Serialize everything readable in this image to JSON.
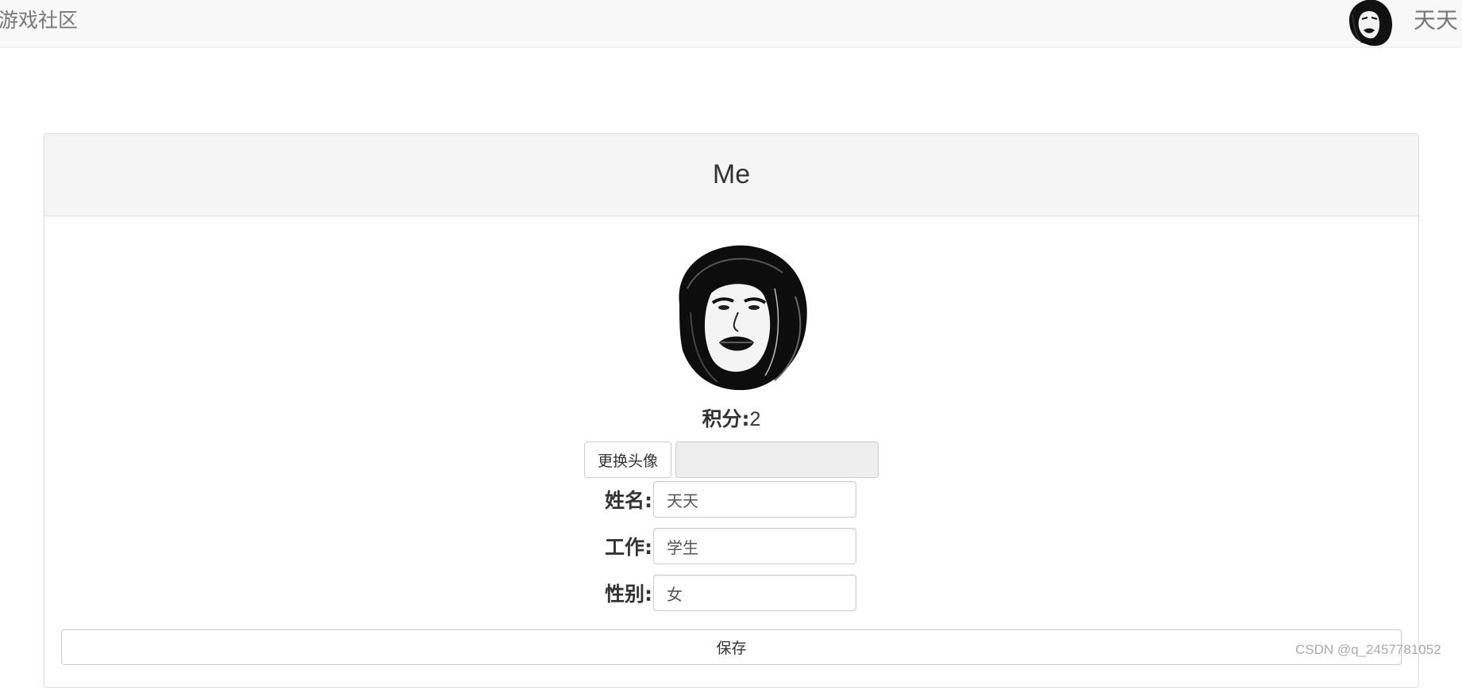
{
  "nav": {
    "brand": "游戏社区",
    "user_name": "天天"
  },
  "panel": {
    "title": "Me"
  },
  "profile": {
    "score_label": "积分",
    "score_sep": ":",
    "score_value": "2",
    "change_avatar_label": "更换头像",
    "name_label": "姓名:",
    "name_value": "天天",
    "job_label": "工作:",
    "job_value": "学生",
    "gender_label": "性别:",
    "gender_value": "女",
    "save_label": "保存"
  },
  "watermark": "CSDN @q_2457781052"
}
